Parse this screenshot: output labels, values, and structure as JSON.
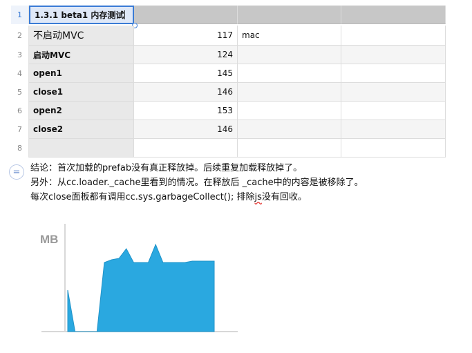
{
  "table": {
    "rows": [
      {
        "num": "1",
        "c1": "1.3.1 beta1 内存测试",
        "c2": "",
        "c3": "",
        "c4": ""
      },
      {
        "num": "2",
        "c1": "不启动MVC",
        "c2": "117",
        "c3": "mac",
        "c4": ""
      },
      {
        "num": "3",
        "c1": "启动MVC",
        "c2": "124",
        "c3": "",
        "c4": ""
      },
      {
        "num": "4",
        "c1": "open1",
        "c2": "145",
        "c3": "",
        "c4": ""
      },
      {
        "num": "5",
        "c1": "close1",
        "c2": "146",
        "c3": "",
        "c4": ""
      },
      {
        "num": "6",
        "c1": "open2",
        "c2": "153",
        "c3": "",
        "c4": ""
      },
      {
        "num": "7",
        "c1": "close2",
        "c2": "146",
        "c3": "",
        "c4": ""
      },
      {
        "num": "8",
        "c1": "",
        "c2": "",
        "c3": "",
        "c4": ""
      }
    ]
  },
  "notes": {
    "line1": "结论：首次加载的prefab没有真正释放掉。后续重复加载释放掉了。",
    "line2": "另外：从cc.loader._cache里看到的情况。在释放后 _cache中的内容是被移除了。",
    "line3_a": "每次close面板都有调用cc.sys.garbageCollect(); 排除",
    "line3_js": "js",
    "line3_b": "没有回收。"
  },
  "chart_data": {
    "type": "area",
    "title": "",
    "ylabel": "MB",
    "fill_color": "#2aa8e0",
    "x": [
      0,
      1,
      2,
      3,
      4,
      5,
      6,
      7,
      8,
      9,
      10,
      11,
      12,
      13,
      14,
      15,
      16,
      17,
      18,
      19,
      20
    ],
    "values": [
      30,
      0,
      0,
      0,
      0,
      50,
      52,
      53,
      60,
      50,
      50,
      50,
      63,
      50,
      50,
      50,
      50,
      51,
      51,
      51,
      51
    ],
    "ylim": [
      0,
      70
    ]
  }
}
